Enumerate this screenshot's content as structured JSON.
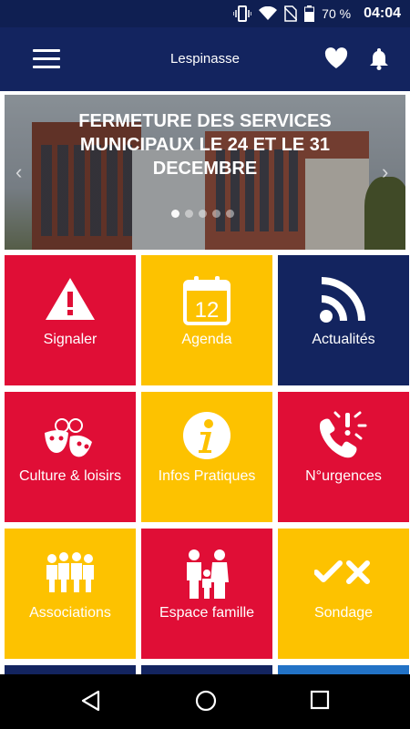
{
  "status_bar": {
    "battery": "70 %",
    "time": "04:04"
  },
  "app_bar": {
    "title": "Lespinasse"
  },
  "banner": {
    "headline": "FERMETURE DES SERVICES MUNICIPAUX LE 24 ET LE 31 DECEMBRE",
    "prev": "‹",
    "next": "›",
    "slides": 5,
    "active_slide": 1
  },
  "calendar_day": "12",
  "tiles": [
    {
      "label": "Signaler",
      "icon": "warning-icon",
      "color": "#e00e36"
    },
    {
      "label": "Agenda",
      "icon": "calendar-icon",
      "color": "#fdc200"
    },
    {
      "label": "Actualités",
      "icon": "rss-icon",
      "color": "#13245f"
    },
    {
      "label": "Culture & loisirs",
      "icon": "culture-masks-icon",
      "color": "#e00e36"
    },
    {
      "label": "Infos Pratiques",
      "icon": "info-icon",
      "color": "#fdc200"
    },
    {
      "label": "N°urgences",
      "icon": "phone-ringing-icon",
      "color": "#e00e36"
    },
    {
      "label": "Associations",
      "icon": "people-group-icon",
      "color": "#fdc200"
    },
    {
      "label": "Espace famille",
      "icon": "family-icon",
      "color": "#e00e36"
    },
    {
      "label": "Sondage",
      "icon": "check-cross-icon",
      "color": "#fdc200"
    }
  ]
}
